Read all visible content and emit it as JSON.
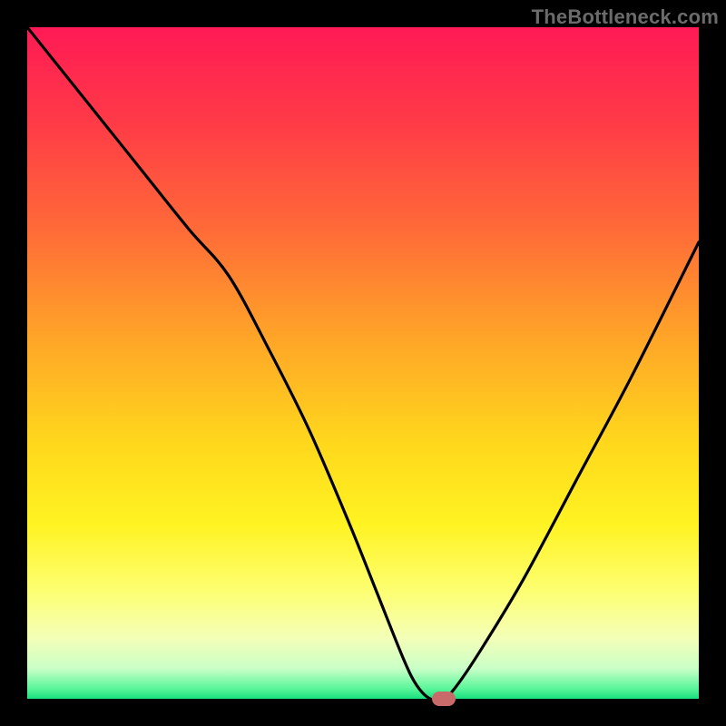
{
  "watermark": "TheBottleneck.com",
  "colors": {
    "black": "#000000",
    "curve": "#000000",
    "marker": "#C96A6A",
    "watermark": "#6B6B6B",
    "gradient_stops": [
      {
        "offset": 0.0,
        "color": "#FF1A55"
      },
      {
        "offset": 0.14,
        "color": "#FF3A47"
      },
      {
        "offset": 0.3,
        "color": "#FF6A38"
      },
      {
        "offset": 0.46,
        "color": "#FFA428"
      },
      {
        "offset": 0.62,
        "color": "#FFD81C"
      },
      {
        "offset": 0.74,
        "color": "#FFF322"
      },
      {
        "offset": 0.84,
        "color": "#FDFF72"
      },
      {
        "offset": 0.91,
        "color": "#F4FFB8"
      },
      {
        "offset": 0.955,
        "color": "#C9FFC7"
      },
      {
        "offset": 0.985,
        "color": "#59F59A"
      },
      {
        "offset": 1.0,
        "color": "#18E07E"
      }
    ]
  },
  "chart_data": {
    "type": "line",
    "title": "",
    "xlabel": "",
    "ylabel": "",
    "xlim": [
      0,
      100
    ],
    "ylim": [
      0,
      100
    ],
    "grid": false,
    "legend": false,
    "series": [
      {
        "name": "bottleneck-curve",
        "x": [
          0,
          8,
          16,
          24,
          30,
          36,
          42,
          48,
          52,
          56,
          58,
          60,
          62,
          64,
          68,
          74,
          82,
          90,
          100
        ],
        "y": [
          100,
          90,
          80,
          70,
          63,
          52,
          40,
          26,
          16,
          6,
          2,
          0,
          0,
          2,
          8,
          18,
          33,
          48,
          68
        ]
      }
    ],
    "marker": {
      "x": 62,
      "y": 0
    }
  }
}
